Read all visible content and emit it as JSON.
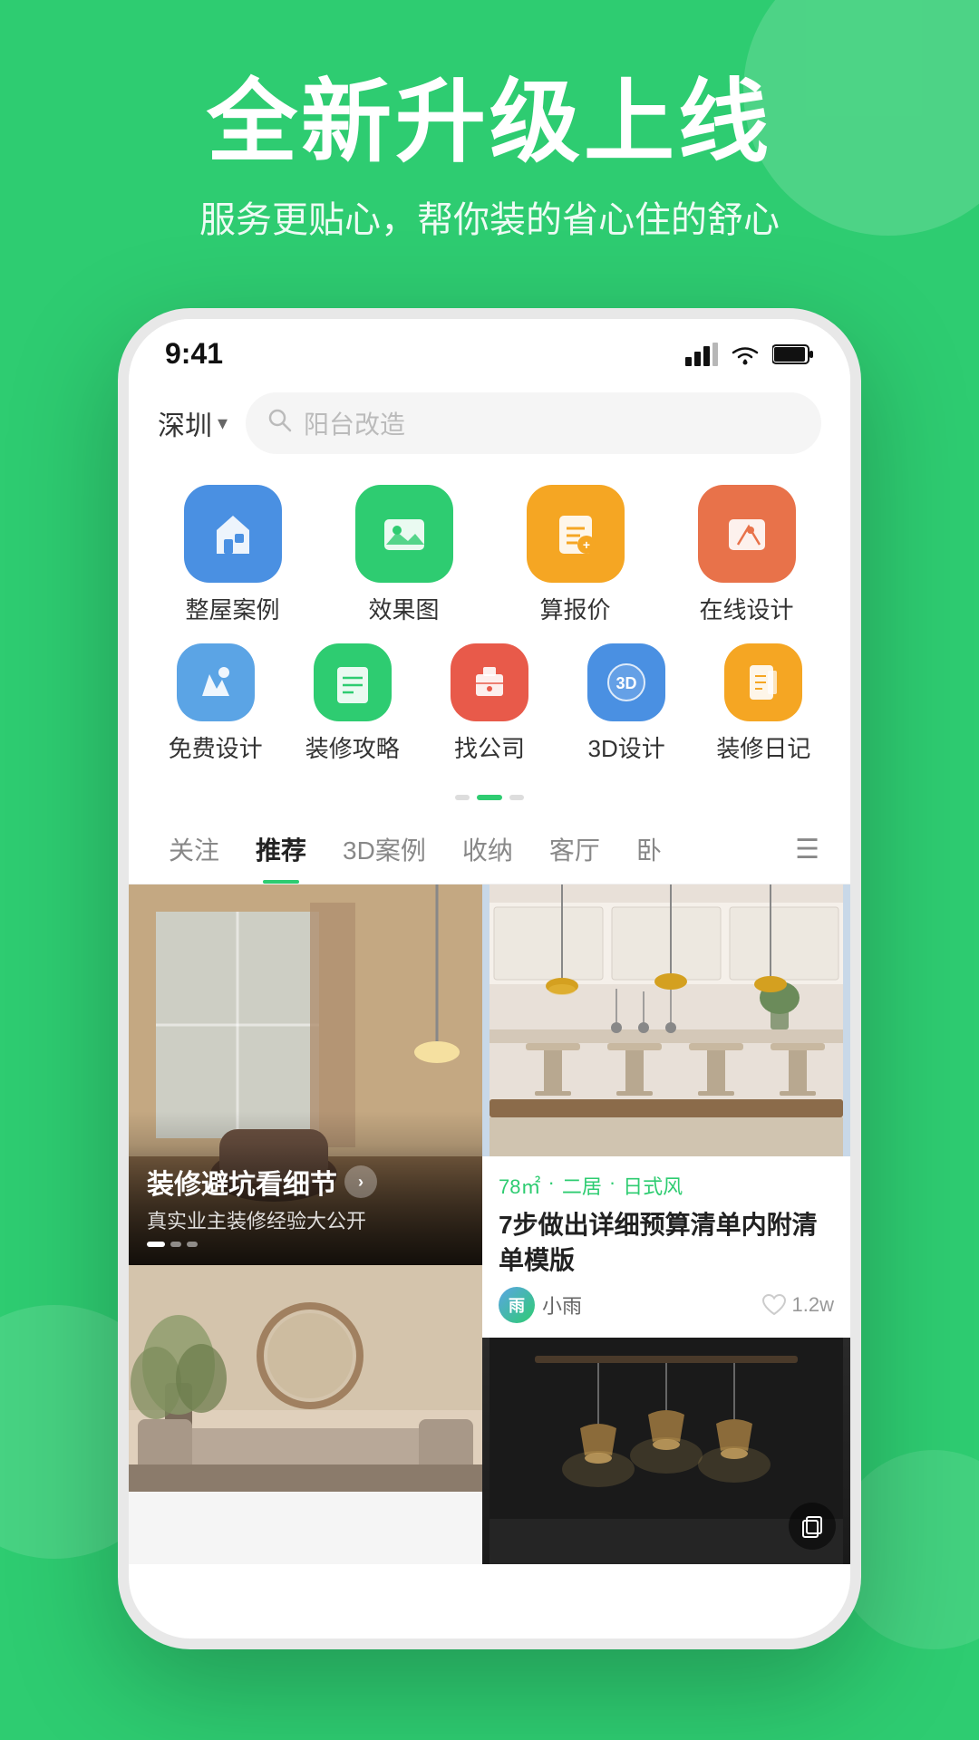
{
  "app": {
    "hero": {
      "title": "全新升级上线",
      "subtitle": "服务更贴心，帮你装的省心住的舒心"
    }
  },
  "statusBar": {
    "time": "9:41",
    "signal": "📶",
    "wifi": "🛜",
    "battery": "🔋"
  },
  "header": {
    "city": "深圳",
    "searchPlaceholder": "阳台改造"
  },
  "categories": {
    "row1": [
      {
        "label": "整屋案例",
        "iconColor": "icon-blue",
        "iconChar": "🏠"
      },
      {
        "label": "效果图",
        "iconColor": "icon-green",
        "iconChar": "🖼️"
      },
      {
        "label": "算报价",
        "iconColor": "icon-orange",
        "iconChar": "💰"
      },
      {
        "label": "在线设计",
        "iconColor": "icon-red-orange",
        "iconChar": "✏️"
      }
    ],
    "row2": [
      {
        "label": "免费设计",
        "iconColor": "icon-light-blue",
        "iconChar": "🎨"
      },
      {
        "label": "装修攻略",
        "iconColor": "icon-teal",
        "iconChar": "📋"
      },
      {
        "label": "找公司",
        "iconColor": "icon-red",
        "iconChar": "📍"
      },
      {
        "label": "3D设计",
        "iconColor": "icon-3d",
        "iconChar": "🔷"
      },
      {
        "label": "装修日记",
        "iconColor": "icon-yellow",
        "iconChar": "📒"
      }
    ]
  },
  "tabs": [
    {
      "label": "关注",
      "active": false
    },
    {
      "label": "推荐",
      "active": true
    },
    {
      "label": "3D案例",
      "active": false
    },
    {
      "label": "收纳",
      "active": false
    },
    {
      "label": "客厅",
      "active": false
    },
    {
      "label": "卧",
      "active": false
    }
  ],
  "cards": {
    "featured": {
      "title": "装修避坑看细节",
      "subtitle": "真实业主装修经验大公开"
    },
    "rightTop": {
      "tags": [
        "78㎡",
        "·",
        "二居",
        "·",
        "日式风"
      ],
      "title": "7步做出详细预算清单内附清单模版",
      "author": "小雨",
      "likes": "1.2w"
    }
  },
  "colors": {
    "primary": "#2ECC71",
    "background": "#2ECC71",
    "phoneFrame": "#ffffff"
  }
}
